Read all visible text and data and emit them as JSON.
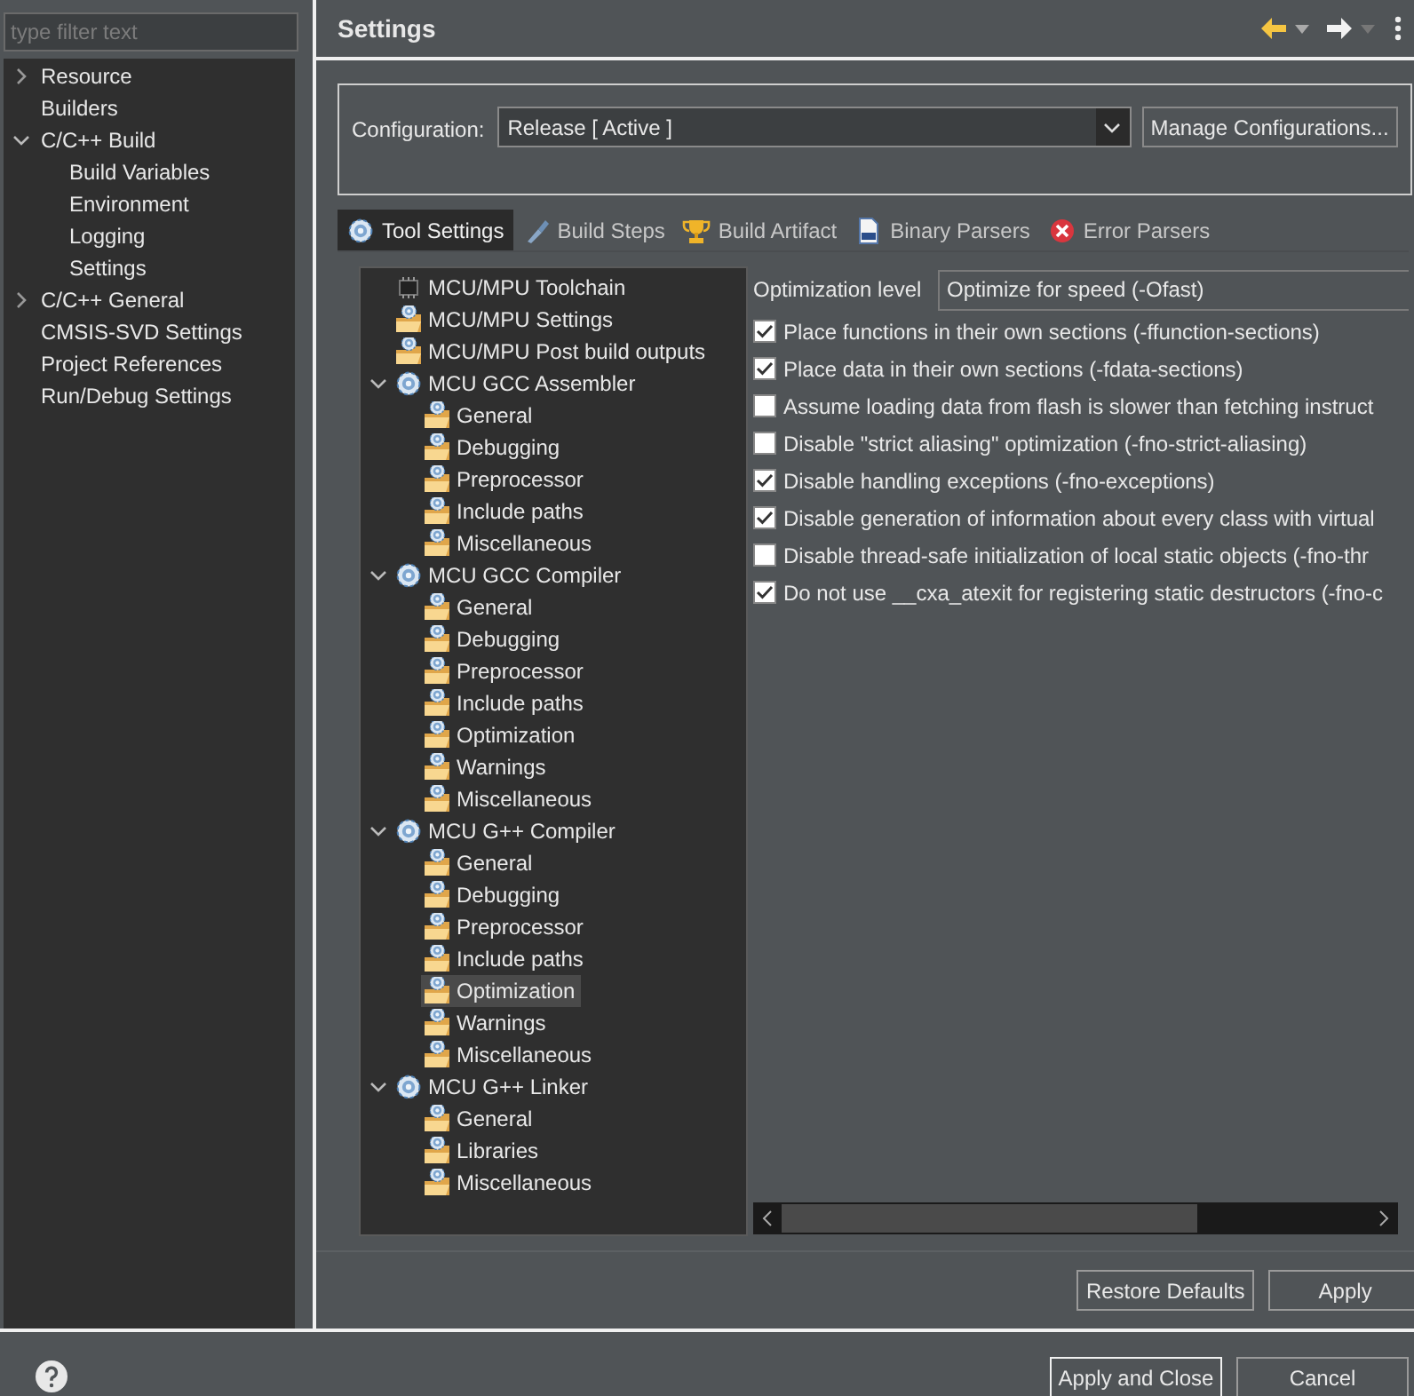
{
  "filter": {
    "placeholder": "type filter text"
  },
  "nav": [
    {
      "label": "Resource",
      "expanded": false
    },
    {
      "label": "Builders"
    },
    {
      "label": "C/C++ Build",
      "expanded": true,
      "children": [
        {
          "label": "Build Variables"
        },
        {
          "label": "Environment"
        },
        {
          "label": "Logging"
        },
        {
          "label": "Settings"
        }
      ]
    },
    {
      "label": "C/C++ General",
      "expanded": false
    },
    {
      "label": "CMSIS-SVD Settings"
    },
    {
      "label": "Project References"
    },
    {
      "label": "Run/Debug Settings"
    }
  ],
  "page_title": "Settings",
  "configuration": {
    "label": "Configuration:",
    "value": "Release  [ Active ]",
    "button": "Manage Configurations..."
  },
  "tabs": [
    {
      "label": "Tool Settings",
      "kind": "gear",
      "selected": true
    },
    {
      "label": "Build Steps",
      "kind": "brush",
      "selected": false
    },
    {
      "label": "Build Artifact",
      "kind": "trophy",
      "selected": false
    },
    {
      "label": "Binary Parsers",
      "kind": "binary",
      "selected": false
    },
    {
      "label": "Error Parsers",
      "kind": "error",
      "selected": false
    }
  ],
  "tool_tree": [
    {
      "label": "MCU/MPU Toolchain",
      "kind": "chip",
      "selected": false
    },
    {
      "label": "MCU/MPU Settings",
      "kind": "folder",
      "selected": false
    },
    {
      "label": "MCU/MPU Post build outputs",
      "kind": "folder",
      "selected": false
    },
    {
      "label": "MCU GCC Assembler",
      "kind": "tool",
      "expanded": true,
      "selected": false,
      "children": [
        {
          "label": "General",
          "kind": "folder",
          "selected": false
        },
        {
          "label": "Debugging",
          "kind": "folder",
          "selected": false
        },
        {
          "label": "Preprocessor",
          "kind": "folder",
          "selected": false
        },
        {
          "label": "Include paths",
          "kind": "folder",
          "selected": false
        },
        {
          "label": "Miscellaneous",
          "kind": "folder",
          "selected": false
        }
      ]
    },
    {
      "label": "MCU GCC Compiler",
      "kind": "tool",
      "expanded": true,
      "selected": false,
      "children": [
        {
          "label": "General",
          "kind": "folder",
          "selected": false
        },
        {
          "label": "Debugging",
          "kind": "folder",
          "selected": false
        },
        {
          "label": "Preprocessor",
          "kind": "folder",
          "selected": false
        },
        {
          "label": "Include paths",
          "kind": "folder",
          "selected": false
        },
        {
          "label": "Optimization",
          "kind": "folder",
          "selected": false
        },
        {
          "label": "Warnings",
          "kind": "folder",
          "selected": false
        },
        {
          "label": "Miscellaneous",
          "kind": "folder",
          "selected": false
        }
      ]
    },
    {
      "label": "MCU G++ Compiler",
      "kind": "tool",
      "expanded": true,
      "selected": false,
      "children": [
        {
          "label": "General",
          "kind": "folder",
          "selected": false
        },
        {
          "label": "Debugging",
          "kind": "folder",
          "selected": false
        },
        {
          "label": "Preprocessor",
          "kind": "folder",
          "selected": false
        },
        {
          "label": "Include paths",
          "kind": "folder",
          "selected": false
        },
        {
          "label": "Optimization",
          "kind": "folder",
          "selected": true
        },
        {
          "label": "Warnings",
          "kind": "folder",
          "selected": false
        },
        {
          "label": "Miscellaneous",
          "kind": "folder",
          "selected": false
        }
      ]
    },
    {
      "label": "MCU G++ Linker",
      "kind": "tool",
      "expanded": true,
      "selected": false,
      "children": [
        {
          "label": "General",
          "kind": "folder",
          "selected": false
        },
        {
          "label": "Libraries",
          "kind": "folder",
          "selected": false
        },
        {
          "label": "Miscellaneous",
          "kind": "folder",
          "selected": false
        }
      ]
    }
  ],
  "optimization": {
    "label": "Optimization level",
    "value": "Optimize for speed (-Ofast)"
  },
  "options": [
    {
      "label": "Place functions in their own sections (-ffunction-sections)",
      "checked": true
    },
    {
      "label": "Place data in their own sections (-fdata-sections)",
      "checked": true
    },
    {
      "label": "Assume loading data from flash is slower than fetching instruct",
      "checked": false
    },
    {
      "label": "Disable \"strict aliasing\" optimization (-fno-strict-aliasing)",
      "checked": false
    },
    {
      "label": "Disable handling exceptions (-fno-exceptions)",
      "checked": true
    },
    {
      "label": "Disable generation of information about every class with virtual",
      "checked": true
    },
    {
      "label": "Disable thread-safe initialization of local static objects (-fno-thr",
      "checked": false
    },
    {
      "label": "Do not use __cxa_atexit for registering static destructors (-fno-c",
      "checked": true
    }
  ],
  "page_buttons": [
    "Restore Defaults",
    "Apply"
  ],
  "dialog_buttons": [
    "Apply and Close",
    "Cancel"
  ]
}
